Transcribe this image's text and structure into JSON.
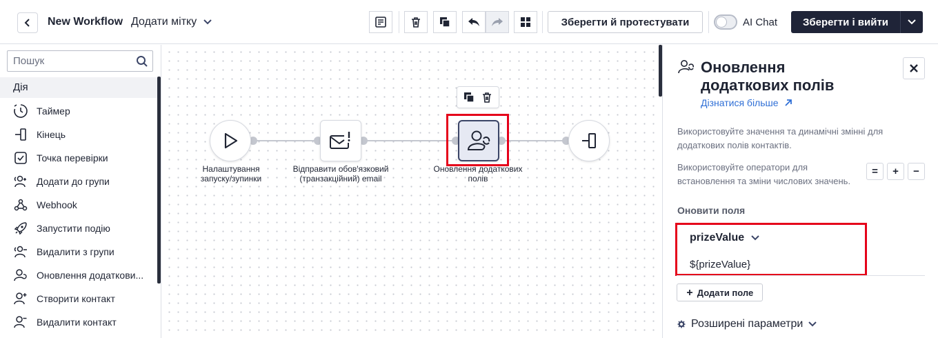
{
  "header": {
    "title": "New Workflow",
    "tag": "Додати мітку",
    "save_test_label": "Зберегти й протестувати",
    "ai_label": "AI Chat",
    "ai_chat_enabled": false,
    "save_exit_label": "Зберегти і вийти"
  },
  "sidebar": {
    "search_placeholder": "Пошук",
    "section_label": "Дія",
    "items": [
      {
        "label": "Таймер",
        "icon": "timer-icon"
      },
      {
        "label": "Кінець",
        "icon": "end-icon"
      },
      {
        "label": "Точка перевірки",
        "icon": "checkpoint-icon"
      },
      {
        "label": "Додати до групи",
        "icon": "add-to-group-icon"
      },
      {
        "label": "Webhook",
        "icon": "webhook-icon"
      },
      {
        "label": "Запустити подію",
        "icon": "rocket-icon"
      },
      {
        "label": "Видалити з групи",
        "icon": "remove-from-group-icon"
      },
      {
        "label": "Оновлення додаткови...",
        "icon": "user-sync-icon"
      },
      {
        "label": "Створити контакт",
        "icon": "user-plus-icon"
      },
      {
        "label": "Видалити контакт",
        "icon": "user-minus-icon"
      }
    ]
  },
  "canvas": {
    "nodes": [
      {
        "label": "Налаштування запуску/зупинки",
        "icon": "play-icon"
      },
      {
        "label": "Відправити обов'язковий (транзакційний) email",
        "icon": "email-alert-icon"
      },
      {
        "label": "Оновлення додаткових полів",
        "icon": "user-sync-icon",
        "selected": true
      },
      {
        "label": "",
        "icon": "end-icon"
      }
    ]
  },
  "panel": {
    "title": "Оновлення додаткових полів",
    "learn_more": "Дізнатися більше",
    "desc1": "Використовуйте значення та динамічні змінні для додаткових полів контактів.",
    "desc2": "Використовуйте оператори для встановлення та зміни числових значень.",
    "operators": [
      "=",
      "+",
      "−"
    ],
    "update_label": "Оновити поля",
    "field": {
      "name": "prizeValue",
      "value": "${prizeValue}"
    },
    "add_field": "Додати поле",
    "advanced": "Розширені параметри"
  },
  "colors": {
    "primary_dark": "#1f2438",
    "link": "#2f6fd6",
    "highlight": "#e5001a"
  }
}
